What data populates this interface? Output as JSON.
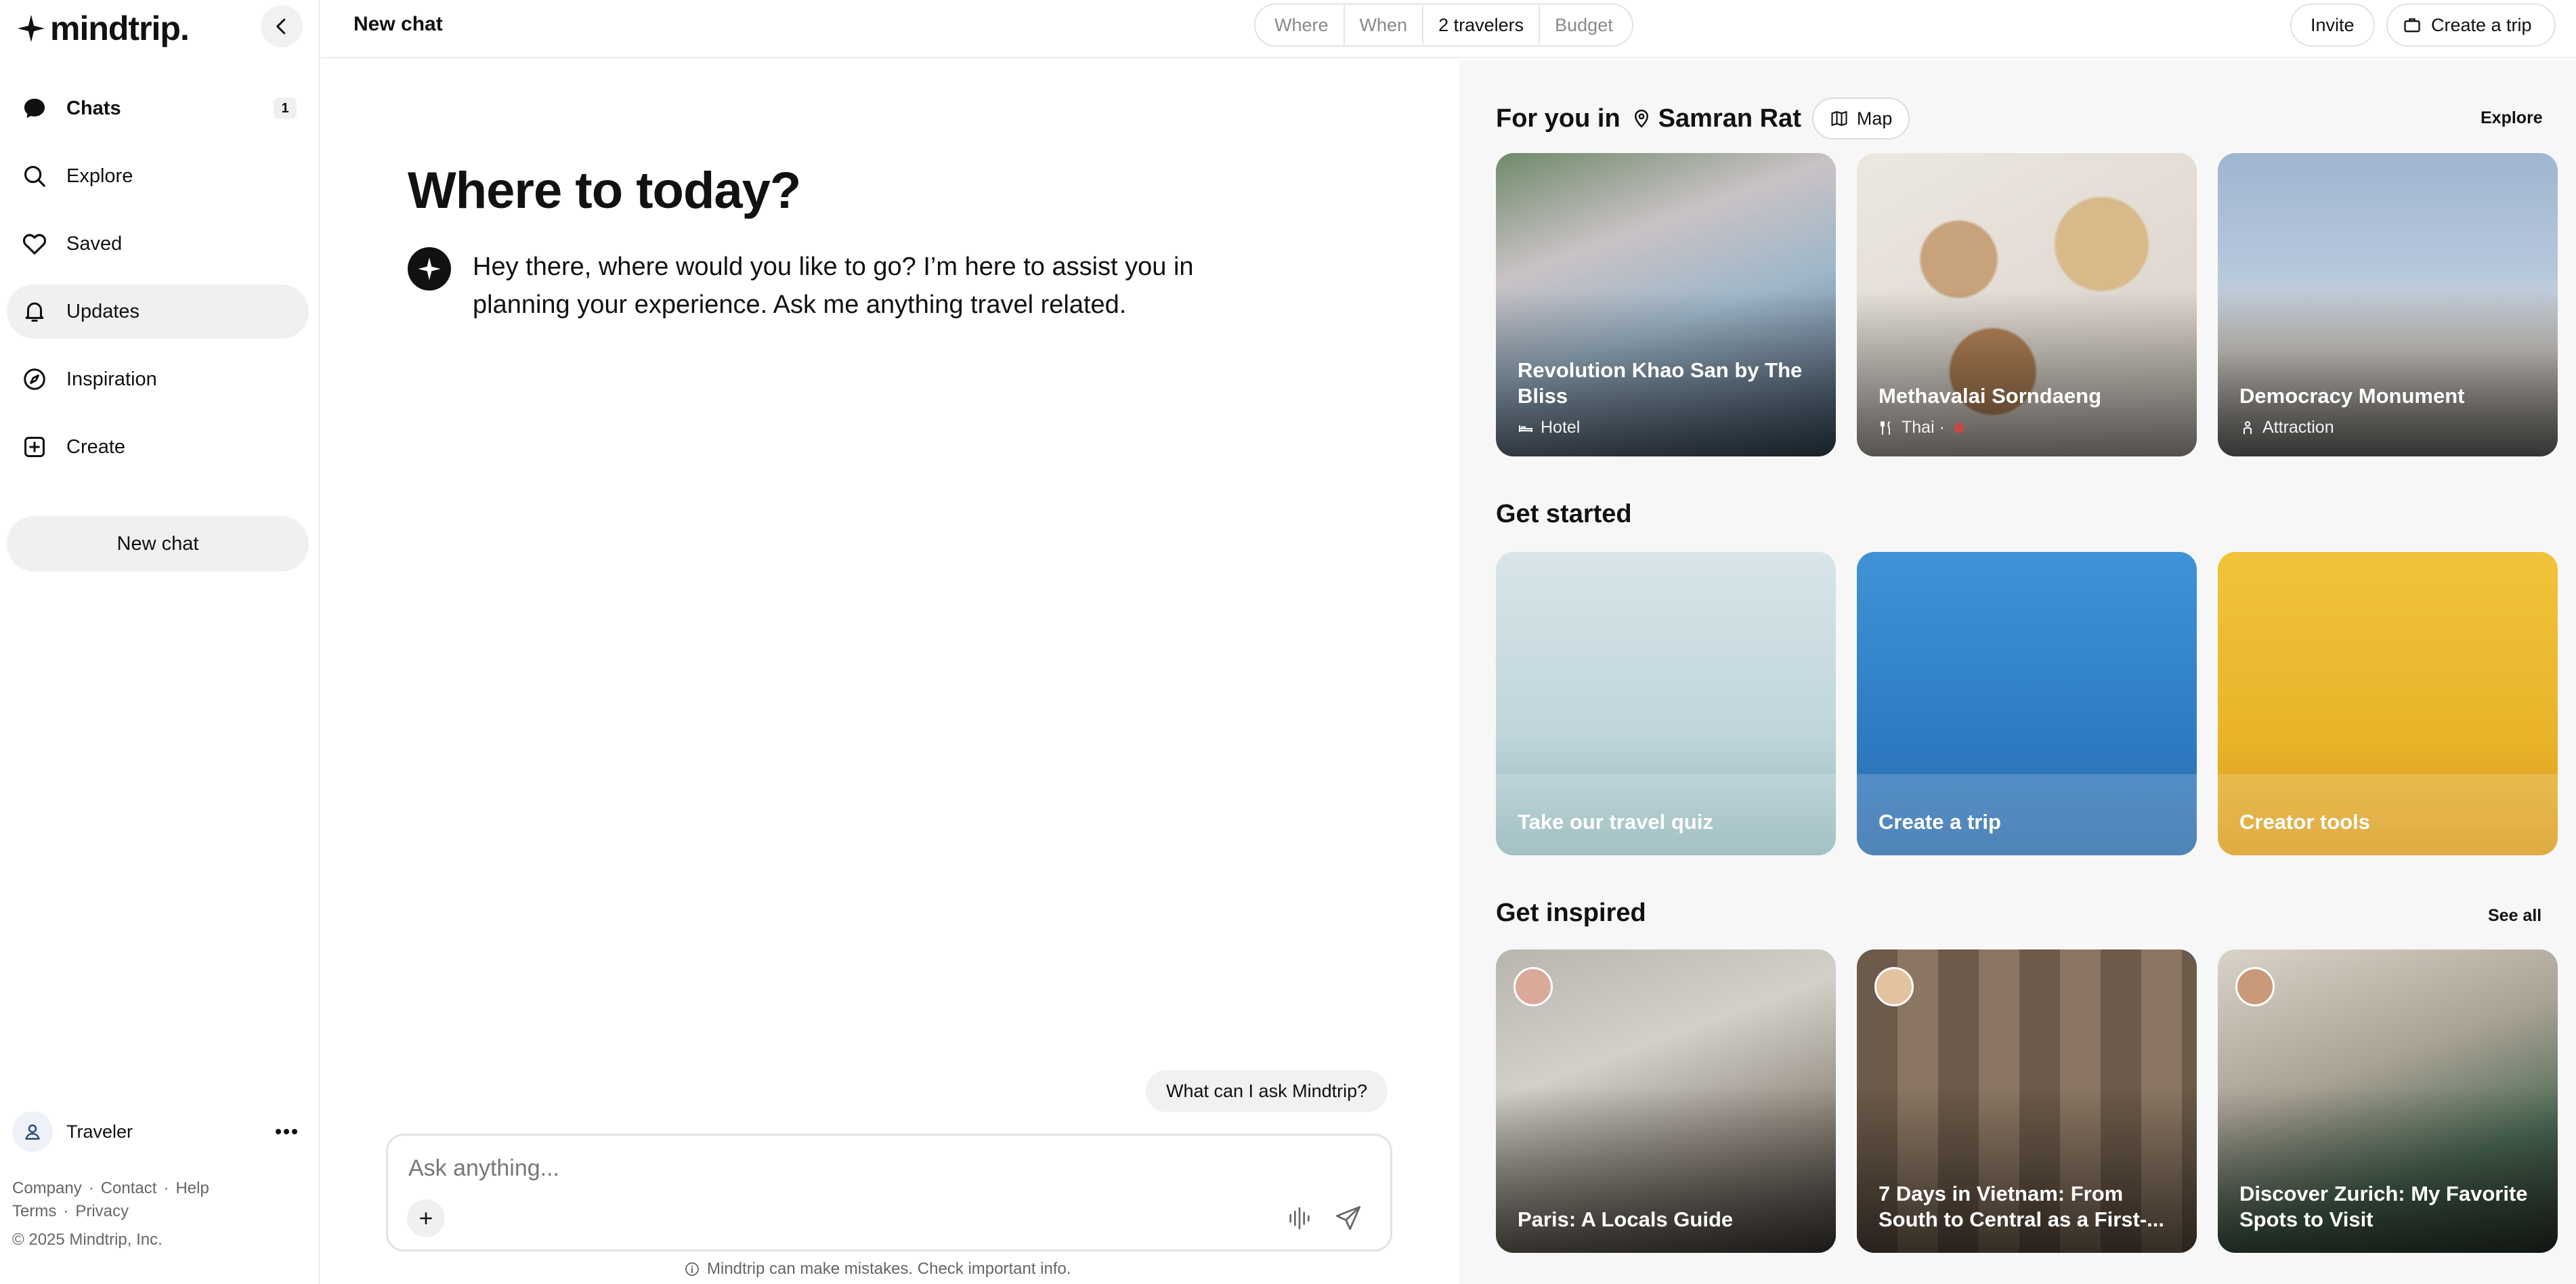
{
  "app": {
    "logo": "mindtrip."
  },
  "sidebar": {
    "items": [
      {
        "label": "Chats",
        "badge": "1"
      },
      {
        "label": "Explore"
      },
      {
        "label": "Saved"
      },
      {
        "label": "Updates"
      },
      {
        "label": "Inspiration"
      },
      {
        "label": "Create"
      }
    ],
    "new_chat": "New chat",
    "user": "Traveler",
    "footer": {
      "company": "Company",
      "contact": "Contact",
      "help": "Help",
      "terms": "Terms",
      "privacy": "Privacy",
      "dot": "·",
      "copyright": "© 2025 Mindtrip, Inc."
    }
  },
  "header": {
    "title": "New chat",
    "filters": [
      "Where",
      "When",
      "2 travelers",
      "Budget"
    ],
    "invite": "Invite",
    "create_trip": "Create a trip"
  },
  "chat": {
    "heading": "Where to today?",
    "message": "Hey there, where would you like to go? I’m here to assist you in planning your experience. Ask me anything travel related.",
    "suggestion": "What can I ask Mindtrip?",
    "input_placeholder": "Ask anything...",
    "disclaimer": "Mindtrip can make mistakes. Check important info."
  },
  "panel": {
    "for_you": {
      "prefix": "For you in",
      "location": "Samran Rat",
      "map_label": "Map",
      "explore_label": "Explore",
      "cards": [
        {
          "title": "Revolution Khao San by The Bliss",
          "type": "Hotel",
          "icon": "bed-icon"
        },
        {
          "title": "Methavalai Sorndaeng",
          "type": "Thai ·",
          "icon": "fork-knife-icon"
        },
        {
          "title": "Democracy Monument",
          "type": "Attraction",
          "icon": "person-icon"
        }
      ]
    },
    "get_started": {
      "heading": "Get started",
      "cards": [
        {
          "title": "Take our travel quiz"
        },
        {
          "title": "Create a trip"
        },
        {
          "title": "Creator tools"
        }
      ]
    },
    "get_inspired": {
      "heading": "Get inspired",
      "see_all": "See all",
      "cards": [
        {
          "title": "Paris: A Locals Guide"
        },
        {
          "title": "7 Days in Vietnam: From South to Central as a First-..."
        },
        {
          "title": "Discover Zurich: My Favorite Spots to Visit"
        }
      ]
    }
  },
  "colors": {
    "accent": "#111111",
    "sidebar_active": "#f0f0f0",
    "panel_bg": "#f7f7f7"
  }
}
